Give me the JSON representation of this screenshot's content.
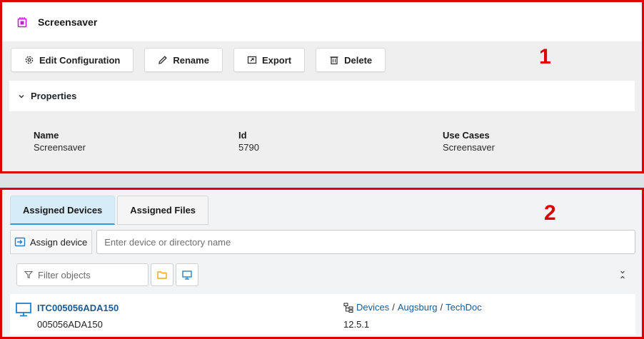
{
  "title": "Screensaver",
  "toolbar": {
    "edit_label": "Edit Configuration",
    "rename_label": "Rename",
    "export_label": "Export",
    "delete_label": "Delete"
  },
  "annotations": {
    "one": "1",
    "two": "2"
  },
  "properties": {
    "header": "Properties",
    "fields": [
      {
        "key": "Name",
        "value": "Screensaver"
      },
      {
        "key": "Id",
        "value": "5790"
      },
      {
        "key": "Use Cases",
        "value": "Screensaver"
      }
    ]
  },
  "tabs": [
    {
      "label": "Assigned Devices",
      "active": true
    },
    {
      "label": "Assigned Files",
      "active": false
    }
  ],
  "assign": {
    "button_label": "Assign device",
    "placeholder": "Enter device or directory name"
  },
  "filter": {
    "placeholder": "Filter objects"
  },
  "device": {
    "name": "ITC005056ADA150",
    "mac": "005056ADA150",
    "path": [
      "Devices",
      "Augsburg",
      "TechDoc"
    ],
    "path_separator": "/",
    "version": "12.5.1"
  },
  "colors": {
    "annotation": "#e00000",
    "accent": "#3a95d6",
    "link": "#1c5a8f",
    "title_icon": "#c21fd6",
    "folder_icon": "#f2a900"
  }
}
